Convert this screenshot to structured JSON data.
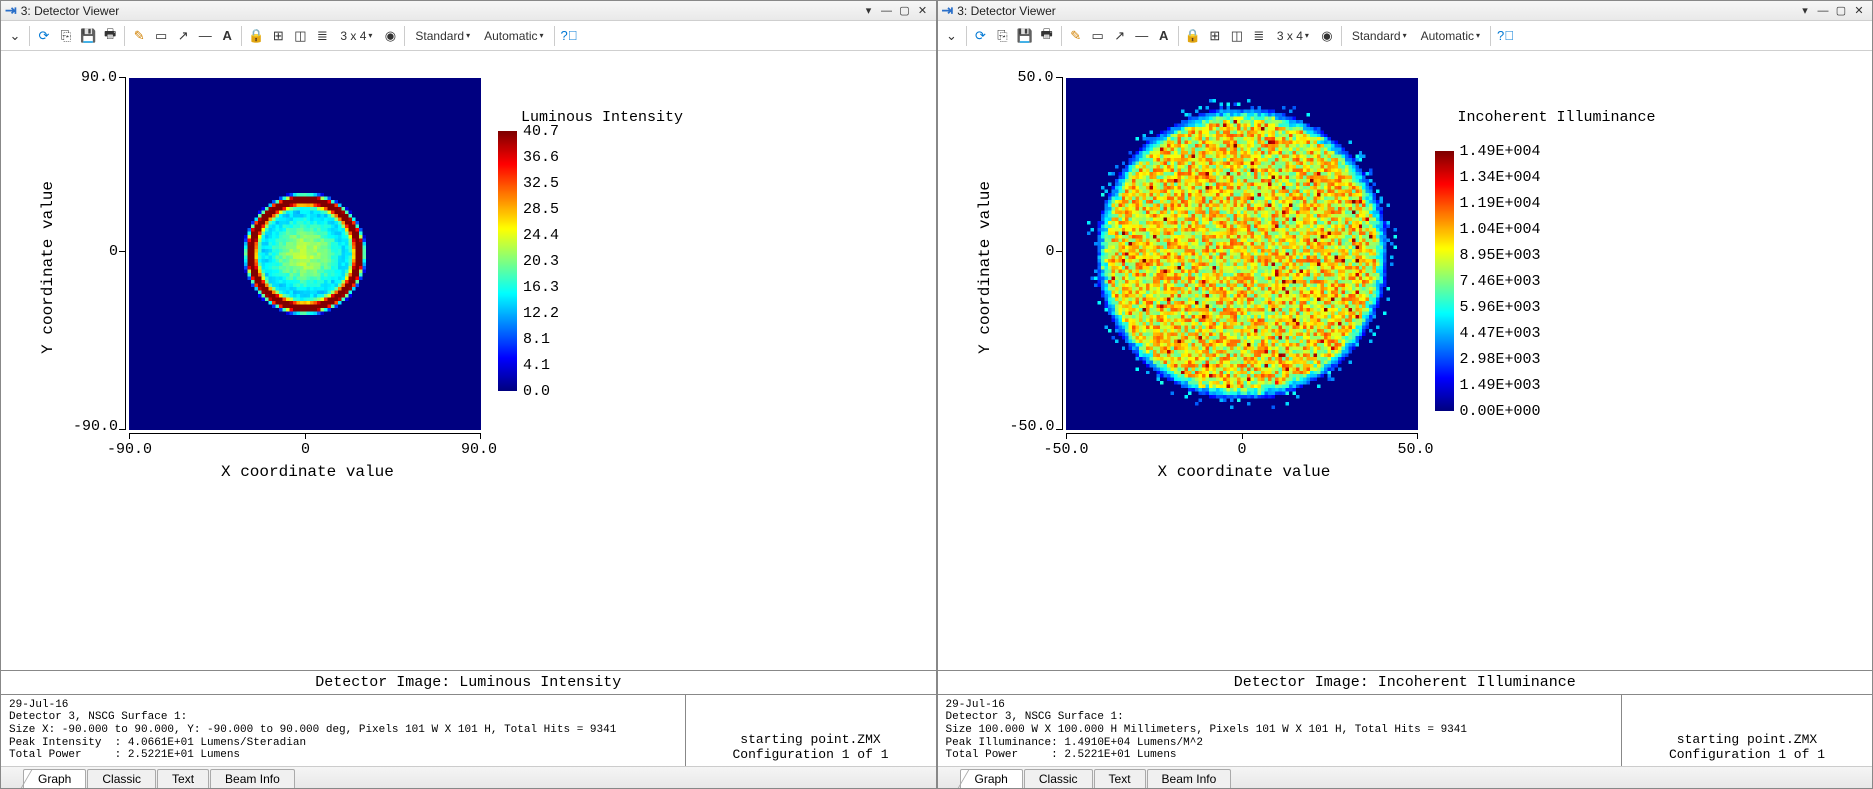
{
  "left": {
    "titlebar": {
      "index": "3:",
      "title": "Detector Viewer"
    },
    "toolbar": {
      "grid_label": "3 x 4",
      "drop1": "Standard",
      "drop2": "Automatic"
    },
    "plot": {
      "ylabel": "Y coordinate value",
      "xlabel": "X coordinate value",
      "yticks": [
        "90.0",
        "0",
        "-90.0"
      ],
      "xticks": [
        "-90.0",
        "0",
        "90.0"
      ],
      "cb_title": "Luminous Intensity",
      "cb_labels": [
        "40.7",
        "36.6",
        "32.5",
        "28.5",
        "24.4",
        "20.3",
        "16.3",
        "12.2",
        "8.1",
        "4.1",
        "0.0"
      ]
    },
    "footer": {
      "title": "Detector Image: Luminous Intensity",
      "details": "29-Jul-16\nDetector 3, NSCG Surface 1:\nSize X: -90.000 to 90.000, Y: -90.000 to 90.000 deg, Pixels 101 W X 101 H, Total Hits = 9341\nPeak Intensity  : 4.0661E+01 Lumens/Steradian\nTotal Power     : 2.5221E+01 Lumens",
      "file": "starting point.ZMX",
      "config": "Configuration 1 of 1"
    },
    "tabs": [
      "Graph",
      "Classic",
      "Text",
      "Beam Info"
    ],
    "active_tab": 0
  },
  "right": {
    "titlebar": {
      "index": "3:",
      "title": "Detector Viewer"
    },
    "toolbar": {
      "grid_label": "3 x 4",
      "drop1": "Standard",
      "drop2": "Automatic"
    },
    "plot": {
      "ylabel": "Y coordinate value",
      "xlabel": "X coordinate value",
      "yticks": [
        "50.0",
        "0",
        "-50.0"
      ],
      "xticks": [
        "-50.0",
        "0",
        "50.0"
      ],
      "cb_title": "Incoherent Illuminance",
      "cb_labels": [
        "1.49E+004",
        "1.34E+004",
        "1.19E+004",
        "1.04E+004",
        "8.95E+003",
        "7.46E+003",
        "5.96E+003",
        "4.47E+003",
        "2.98E+003",
        "1.49E+003",
        "0.00E+000"
      ]
    },
    "footer": {
      "title": "Detector Image: Incoherent Illuminance",
      "details": "29-Jul-16\nDetector 3, NSCG Surface 1:\nSize 100.000 W X 100.000 H Millimeters, Pixels 101 W X 101 H, Total Hits = 9341\nPeak Illuminance: 1.4910E+04 Lumens/M^2\nTotal Power     : 2.5221E+01 Lumens",
      "file": "starting point.ZMX",
      "config": "Configuration 1 of 1"
    },
    "tabs": [
      "Graph",
      "Classic",
      "Text",
      "Beam Info"
    ],
    "active_tab": 0
  },
  "chart_data": [
    {
      "type": "heatmap",
      "title": "Detector Image: Luminous Intensity",
      "xlabel": "X coordinate value",
      "ylabel": "Y coordinate value",
      "xlim": [
        -90.0,
        90.0
      ],
      "ylim": [
        -90.0,
        90.0
      ],
      "zlim": [
        0.0,
        40.7
      ],
      "colorbar_title": "Luminous Intensity",
      "colorbar_ticks": [
        0.0,
        4.1,
        8.1,
        12.2,
        16.3,
        20.3,
        24.4,
        28.5,
        32.5,
        36.6,
        40.7
      ],
      "description": "Circular luminous spot centered near origin, outer diameter ≈ 60 deg. Bright red rim (≈35-40) with green/yellow interior (≈20-28). Background = 0 (blue)."
    },
    {
      "type": "heatmap",
      "title": "Detector Image: Incoherent Illuminance",
      "xlabel": "X coordinate value",
      "ylabel": "Y coordinate value",
      "xlim": [
        -50.0,
        50.0
      ],
      "ylim": [
        -50.0,
        50.0
      ],
      "zlim": [
        0.0,
        14900.0
      ],
      "colorbar_title": "Incoherent Illuminance",
      "colorbar_ticks": [
        0,
        1490,
        2980,
        4470,
        5960,
        7460,
        8950,
        10400,
        11900,
        13400,
        14900
      ],
      "description": "Noisy (speckled) circular illuminance pattern filling ≈ -40..40 in both axes, mean green/cyan (≈6000-9000) with scattered red hot pixels (≈1.3-1.5E4). Background = 0 (blue)."
    }
  ]
}
